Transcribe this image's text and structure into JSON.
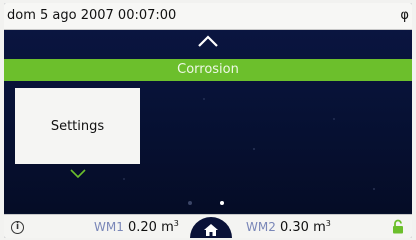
{
  "status_bar": {
    "datetime": "dom 5 ago 2007 00:07:00",
    "right_icon": "antenna-icon"
  },
  "banner": {
    "title": "Corrosion",
    "color": "#6cbf2c"
  },
  "menu": {
    "card_label": "Settings"
  },
  "pager": {
    "total_pages": 2,
    "current_page": 2
  },
  "bottom_bar": {
    "info_icon": "info-icon",
    "wm1": {
      "label": "WM1",
      "value": "0.20",
      "unit": "m",
      "exp": "3"
    },
    "wm2": {
      "label": "WM2",
      "value": "0.30",
      "unit": "m",
      "exp": "3"
    },
    "home_icon": "home-icon",
    "lock_icon": "lock-icon",
    "lock_color": "#6cbf2c"
  },
  "colors": {
    "background": "#07112e",
    "accent": "#6cbf2c"
  }
}
